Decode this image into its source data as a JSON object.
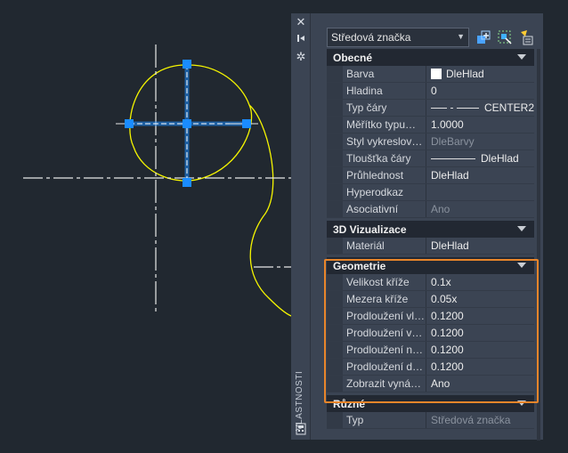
{
  "palette": {
    "background": "#212830",
    "panel": "#3b4453",
    "section_header": "#222832",
    "highlight": "#e8852a",
    "geometry_yellow": "#f5f500",
    "grip_blue": "#1a8cff"
  },
  "strip": {
    "close_icon": "close-icon",
    "autohide_icon": "autohide-icon",
    "settings_icon": "settings-icon",
    "vertical_title": "VLASTNOSTI",
    "bottom_icon": "calculator-icon"
  },
  "toolbar": {
    "selected_object": "Středová značka",
    "icons": [
      "toggle-pickadd-icon",
      "select-objects-icon",
      "quick-select-icon"
    ]
  },
  "sections": [
    {
      "title": "Obecné",
      "rows": [
        {
          "label": "Barva",
          "value": "DleHlad",
          "kind": "swatch"
        },
        {
          "label": "Hladina",
          "value": "0"
        },
        {
          "label": "Typ čáry",
          "value": "CENTER2",
          "kind": "dash"
        },
        {
          "label": "Měřítko typu…",
          "value": "1.0000"
        },
        {
          "label": "Styl vykreslov…",
          "value": "DleBarvy",
          "dim": true
        },
        {
          "label": "Tloušťka čáry",
          "value": "DleHlad",
          "kind": "line"
        },
        {
          "label": "Průhlednost",
          "value": "DleHlad"
        },
        {
          "label": "Hyperodkaz",
          "value": ""
        },
        {
          "label": "Asociativní",
          "value": "Ano",
          "dim": true
        }
      ]
    },
    {
      "title": "3D Vizualizace",
      "rows": [
        {
          "label": "Materiál",
          "value": "DleHlad"
        }
      ]
    },
    {
      "title": "Geometrie",
      "rows": [
        {
          "label": "Velikost kříže",
          "value": "0.1x"
        },
        {
          "label": "Mezera kříže",
          "value": "0.05x"
        },
        {
          "label": "Prodloužení vl…",
          "value": "0.1200"
        },
        {
          "label": "Prodloužení v…",
          "value": "0.1200"
        },
        {
          "label": "Prodloužení n…",
          "value": "0.1200"
        },
        {
          "label": "Prodloužení d…",
          "value": "0.1200"
        },
        {
          "label": "Zobrazit vyná…",
          "value": "Ano"
        }
      ]
    },
    {
      "title": "Různé",
      "rows": [
        {
          "label": "Typ",
          "value": "Středová značka",
          "dim": true
        }
      ]
    }
  ]
}
